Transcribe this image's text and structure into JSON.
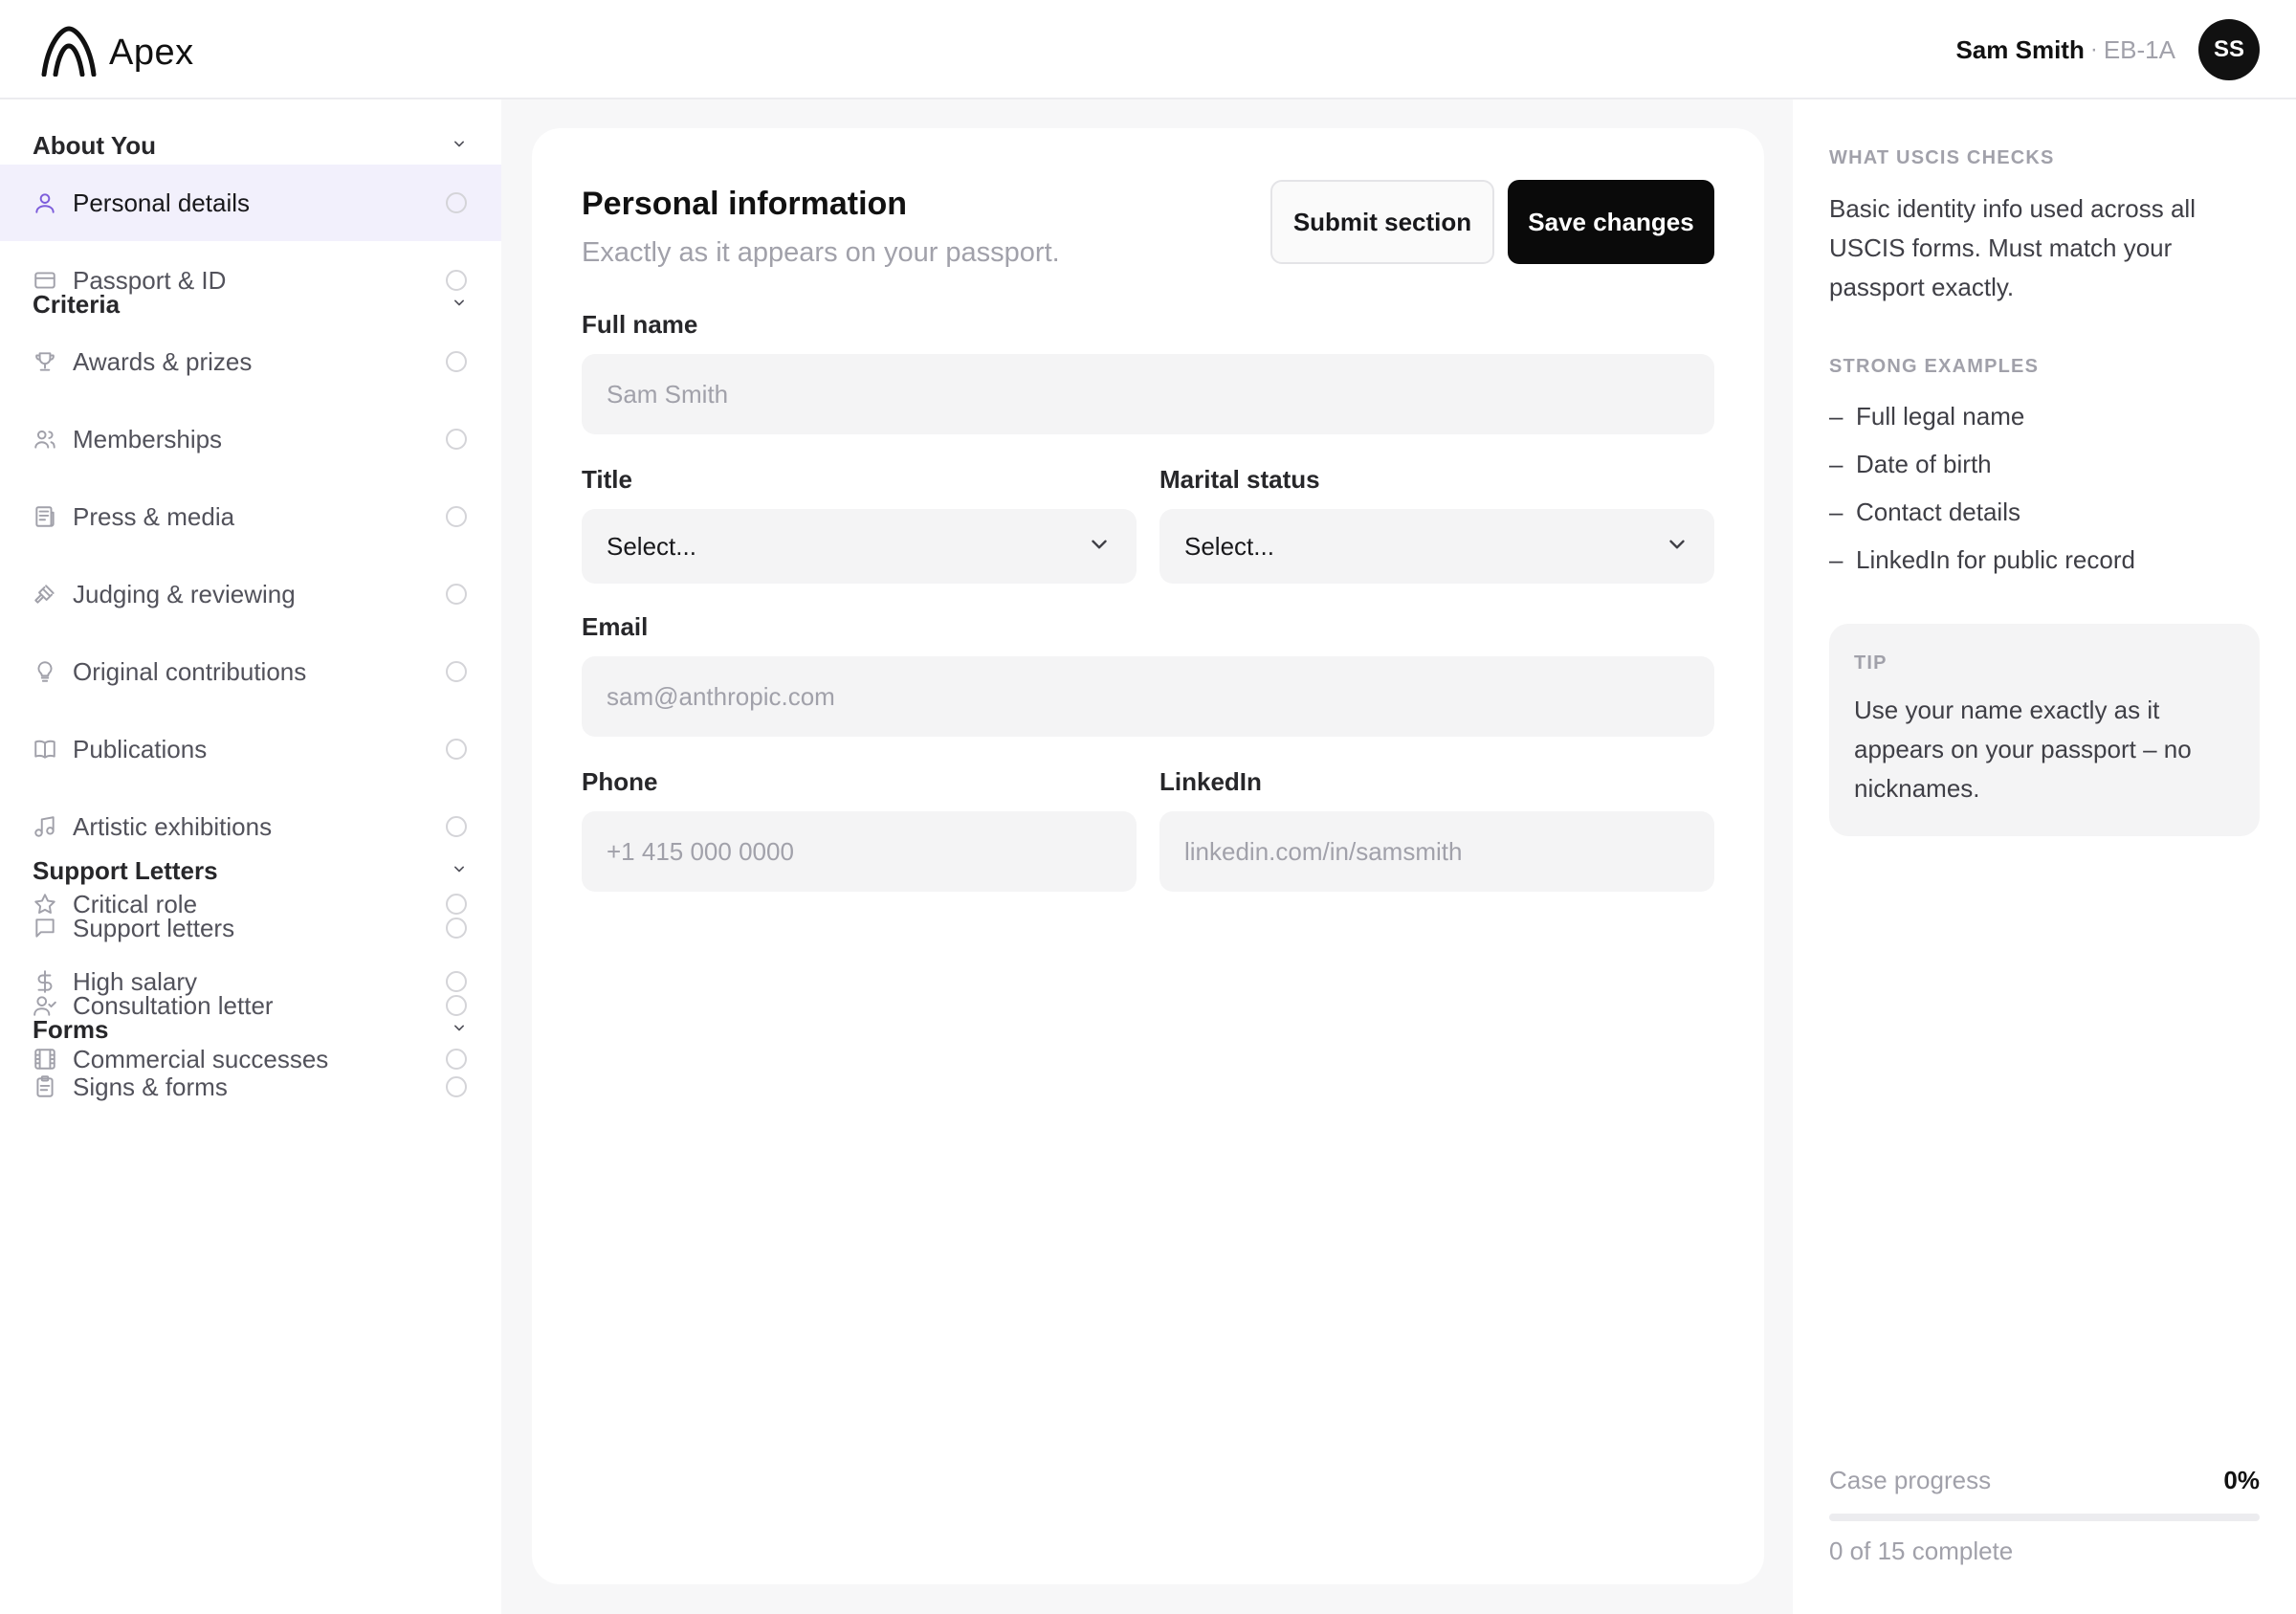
{
  "app": {
    "name": "Apex"
  },
  "user": {
    "name": "Sam Smith",
    "separator": "·",
    "visa": "EB-1A",
    "initials": "SS"
  },
  "sidebar": {
    "sections": [
      {
        "title": "About You",
        "items": [
          {
            "label": "Personal details",
            "icon": "user-icon",
            "active": true
          },
          {
            "label": "Passport & ID",
            "icon": "id-card-icon"
          }
        ]
      },
      {
        "title": "Criteria",
        "items": [
          {
            "label": "Awards & prizes",
            "icon": "trophy-icon"
          },
          {
            "label": "Memberships",
            "icon": "users-icon"
          },
          {
            "label": "Press & media",
            "icon": "newspaper-icon"
          },
          {
            "label": "Judging & reviewing",
            "icon": "gavel-icon"
          },
          {
            "label": "Original contributions",
            "icon": "lightbulb-icon"
          },
          {
            "label": "Publications",
            "icon": "book-icon"
          },
          {
            "label": "Artistic exhibitions",
            "icon": "music-icon"
          },
          {
            "label": "Critical role",
            "icon": "star-icon"
          },
          {
            "label": "High salary",
            "icon": "dollar-icon"
          },
          {
            "label": "Commercial successes",
            "icon": "film-icon"
          }
        ]
      },
      {
        "title": "Support Letters",
        "items": [
          {
            "label": "Support letters",
            "icon": "message-icon"
          },
          {
            "label": "Consultation letter",
            "icon": "user-check-icon"
          }
        ]
      },
      {
        "title": "Forms",
        "items": [
          {
            "label": "Signs & forms",
            "icon": "clipboard-icon"
          }
        ]
      }
    ]
  },
  "main": {
    "title": "Personal information",
    "subtitle": "Exactly as it appears on your passport.",
    "submit_label": "Submit section",
    "save_label": "Save changes",
    "fields": {
      "full_name": {
        "label": "Full name",
        "placeholder": "Sam Smith"
      },
      "title": {
        "label": "Title",
        "value": "Select..."
      },
      "marital_status": {
        "label": "Marital status",
        "value": "Select..."
      },
      "email": {
        "label": "Email",
        "placeholder": "sam@anthropic.com"
      },
      "phone": {
        "label": "Phone",
        "placeholder": "+1 415 000 0000"
      },
      "linkedin": {
        "label": "LinkedIn",
        "placeholder": "linkedin.com/in/samsmith"
      }
    }
  },
  "right_panel": {
    "uscis_heading": "WHAT USCIS CHECKS",
    "uscis_text": "Basic identity info used across all USCIS forms. Must match your passport exactly.",
    "examples_heading": "STRONG EXAMPLES",
    "examples": [
      "Full legal name",
      "Date of birth",
      "Contact details",
      "LinkedIn for public record"
    ],
    "example_dash": "–",
    "tip_label": "TIP",
    "tip_text": "Use your name exactly as it appears on your passport – no nicknames.",
    "progress": {
      "label": "Case progress",
      "percent_text": "0%",
      "fraction": 0,
      "sub": "0 of 15 complete"
    }
  },
  "colors": {
    "accent": "#7c5cdb",
    "active_bg": "#f2f0fc",
    "primary_button": "#0a0a0a"
  }
}
